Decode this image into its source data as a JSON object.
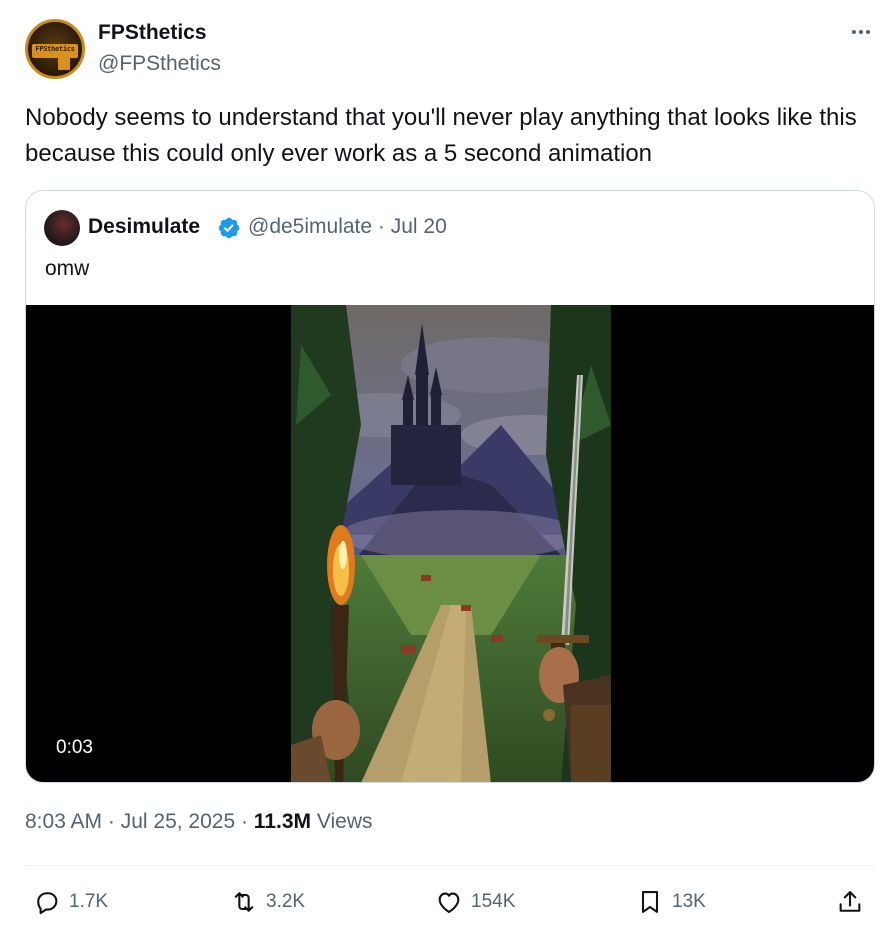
{
  "author": {
    "name": "FPSthetics",
    "handle": "@FPSthetics",
    "avatar_text": "FPSthetics",
    "avatar_icon": "pistol-logo-icon"
  },
  "tweet": {
    "text": "Nobody seems to understand that you'll never play anything that looks like this because this could only ever work as a 5 second animation"
  },
  "quoted": {
    "name": "Desimulate",
    "verified": true,
    "handle_date": "@de5imulate · Jul 20",
    "text": "omw",
    "video_time": "0:03"
  },
  "meta": {
    "time": "8:03 AM · Jul 25, 2025 · ",
    "views_count": "11.3M",
    "views_label": " Views"
  },
  "actions": {
    "replies": "1.7K",
    "reposts": "3.2K",
    "likes": "154K",
    "bookmarks": "13K"
  },
  "colors": {
    "text_primary": "#0f1419",
    "text_secondary": "#536471",
    "verified_blue": "#1d9bf0",
    "avatar_gold": "#d9901c"
  }
}
